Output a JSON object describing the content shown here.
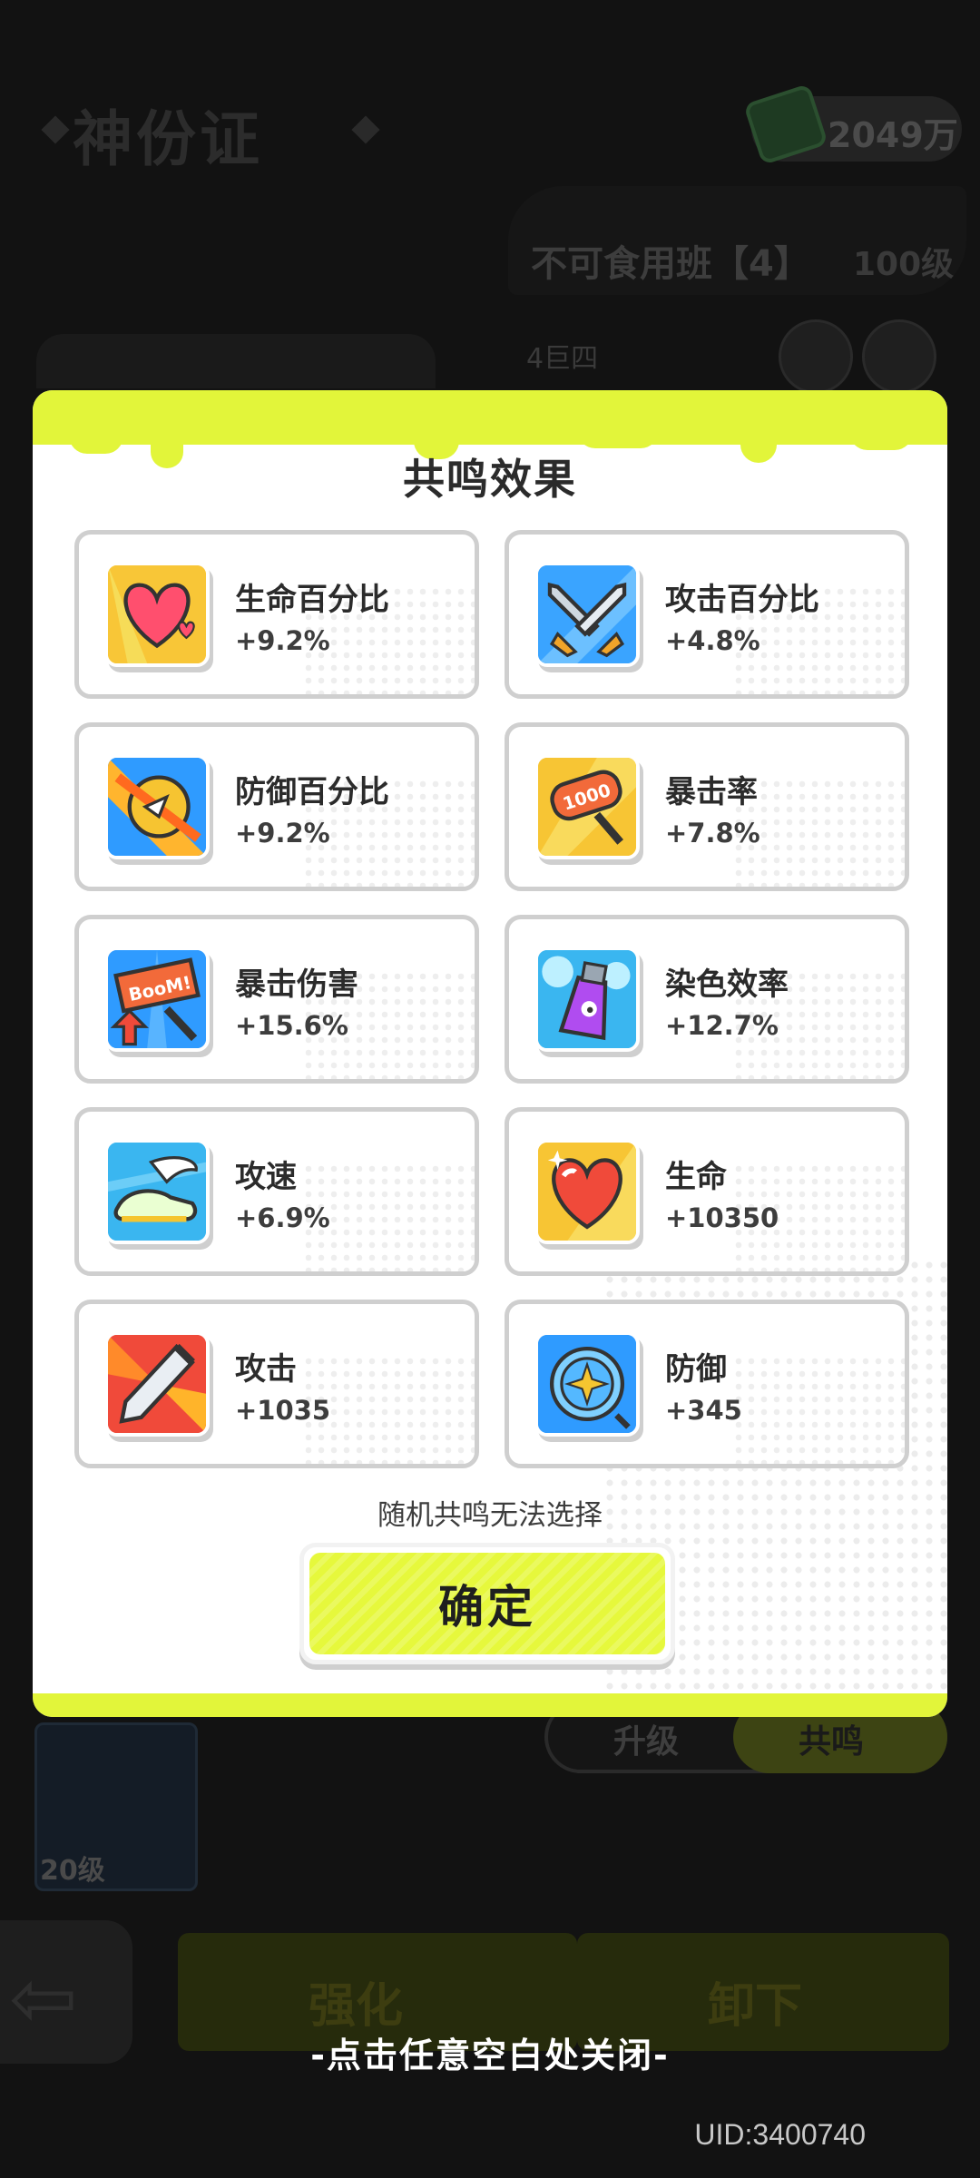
{
  "background": {
    "title": "神份证",
    "currency": "2049万",
    "status": "不可食用班【4】",
    "level": "100级",
    "sub": "4巨四",
    "card_level": "20级",
    "tab_upgrade": "升级",
    "tab_resonance": "共鸣",
    "enhance_button": "强化",
    "unequip_button": "卸下"
  },
  "modal": {
    "title": "共鸣效果",
    "effects": [
      {
        "name": "生命百分比",
        "value": "+9.2%",
        "icon": "heart-percent-icon"
      },
      {
        "name": "攻击百分比",
        "value": "+4.8%",
        "icon": "sword-percent-icon"
      },
      {
        "name": "防御百分比",
        "value": "+9.2%",
        "icon": "shield-break-icon"
      },
      {
        "name": "暴击率",
        "value": "+7.8%",
        "icon": "crit-hammer-icon"
      },
      {
        "name": "暴击伤害",
        "value": "+15.6%",
        "icon": "boom-sign-icon"
      },
      {
        "name": "染色效率",
        "value": "+12.7%",
        "icon": "paint-bottle-icon"
      },
      {
        "name": "攻速",
        "value": "+6.9%",
        "icon": "winged-shoe-icon"
      },
      {
        "name": "生命",
        "value": "+10350",
        "icon": "heart-icon"
      },
      {
        "name": "攻击",
        "value": "+1035",
        "icon": "blade-icon"
      },
      {
        "name": "防御",
        "value": "+345",
        "icon": "round-shield-icon"
      }
    ],
    "note": "随机共鸣无法选择",
    "confirm_label": "确定"
  },
  "close_hint": "-点击任意空白处关闭-",
  "uid": "UID:3400740",
  "colors": {
    "accent": "#e2f53a",
    "card_border": "#cfcfcf"
  }
}
